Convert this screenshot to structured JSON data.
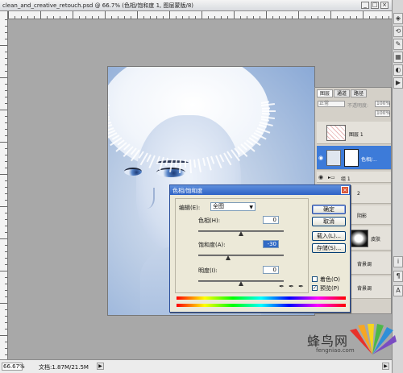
{
  "window": {
    "title": "clean_and_creative_retouch.psd @ 66.7% (色相/饱和度 1, 图层蒙版/8)"
  },
  "status": {
    "zoom": "66.67%",
    "doc_info": "文档:1.87M/21.5M"
  },
  "layers_panel": {
    "tabs": [
      "图层",
      "通道",
      "路径"
    ],
    "blend_mode": "正常",
    "opacity_label": "不透明度:",
    "opacity_value": "100%",
    "fill_value": "100%",
    "layers": [
      {
        "name": "图层 1"
      },
      {
        "name": "色相/...",
        "selected": true
      },
      {
        "name": "组 1"
      },
      {
        "name": "2"
      },
      {
        "name": "阴影"
      },
      {
        "name": "皮肤"
      },
      {
        "name": "背景调"
      },
      {
        "name": "背景调"
      }
    ]
  },
  "hue_sat_dialog": {
    "title": "色相/饱和度",
    "edit_label": "编辑(E):",
    "edit_value": "全图",
    "hue_label": "色相(H):",
    "hue_value": "0",
    "saturation_label": "饱和度(A):",
    "saturation_value": "-30",
    "lightness_label": "明度(I):",
    "lightness_value": "0",
    "ok_label": "确定",
    "cancel_label": "取消",
    "load_label": "载入(L)...",
    "save_label": "存储(S)...",
    "colorize_label": "着色(O)",
    "colorize_checked": false,
    "preview_label": "预览(P)",
    "preview_checked": true,
    "hue_position": 0.5,
    "saturation_position": 0.35,
    "lightness_position": 0.5
  },
  "watermark": {
    "text": "蜂鸟网",
    "url": "fengniao.com"
  }
}
